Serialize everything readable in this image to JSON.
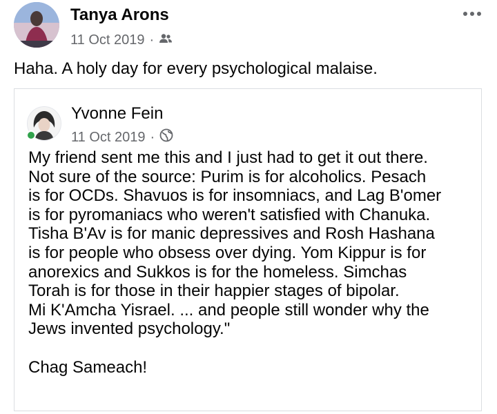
{
  "post": {
    "author": "Tanya Arons",
    "date": "11 Oct 2019",
    "separator": "·",
    "privacy_icon": "friends-icon",
    "text": "Haha. A holy day for every psychological malaise."
  },
  "shared_post": {
    "author": "Yvonne Fein",
    "date": "11 Oct 2019",
    "separator": "·",
    "privacy_icon": "globe-icon",
    "lines": [
      "My friend sent me this and I just had to get it out there.",
      "Not sure of the source: Purim is for alcoholics. Pesach",
      "is for OCDs. Shavuos is for insomniacs, and Lag B'omer",
      "is for pyromaniacs who weren't satisfied with Chanuka.",
      "Tisha B'Av is for manic depressives and Rosh Hashana",
      "is for people who obsess over dying. Yom Kippur is for",
      "anorexics and Sukkos is for the homeless. Simchas",
      "Torah is for those in their happier stages of bipolar.",
      "Mi K'Amcha Yisrael. ... and people still wonder why the",
      "Jews invented psychology.\"",
      "",
      "Chag Sameach!"
    ]
  },
  "colors": {
    "text": "#050505",
    "secondary": "#65676b",
    "border": "#dadde1",
    "online": "#31a24c"
  }
}
